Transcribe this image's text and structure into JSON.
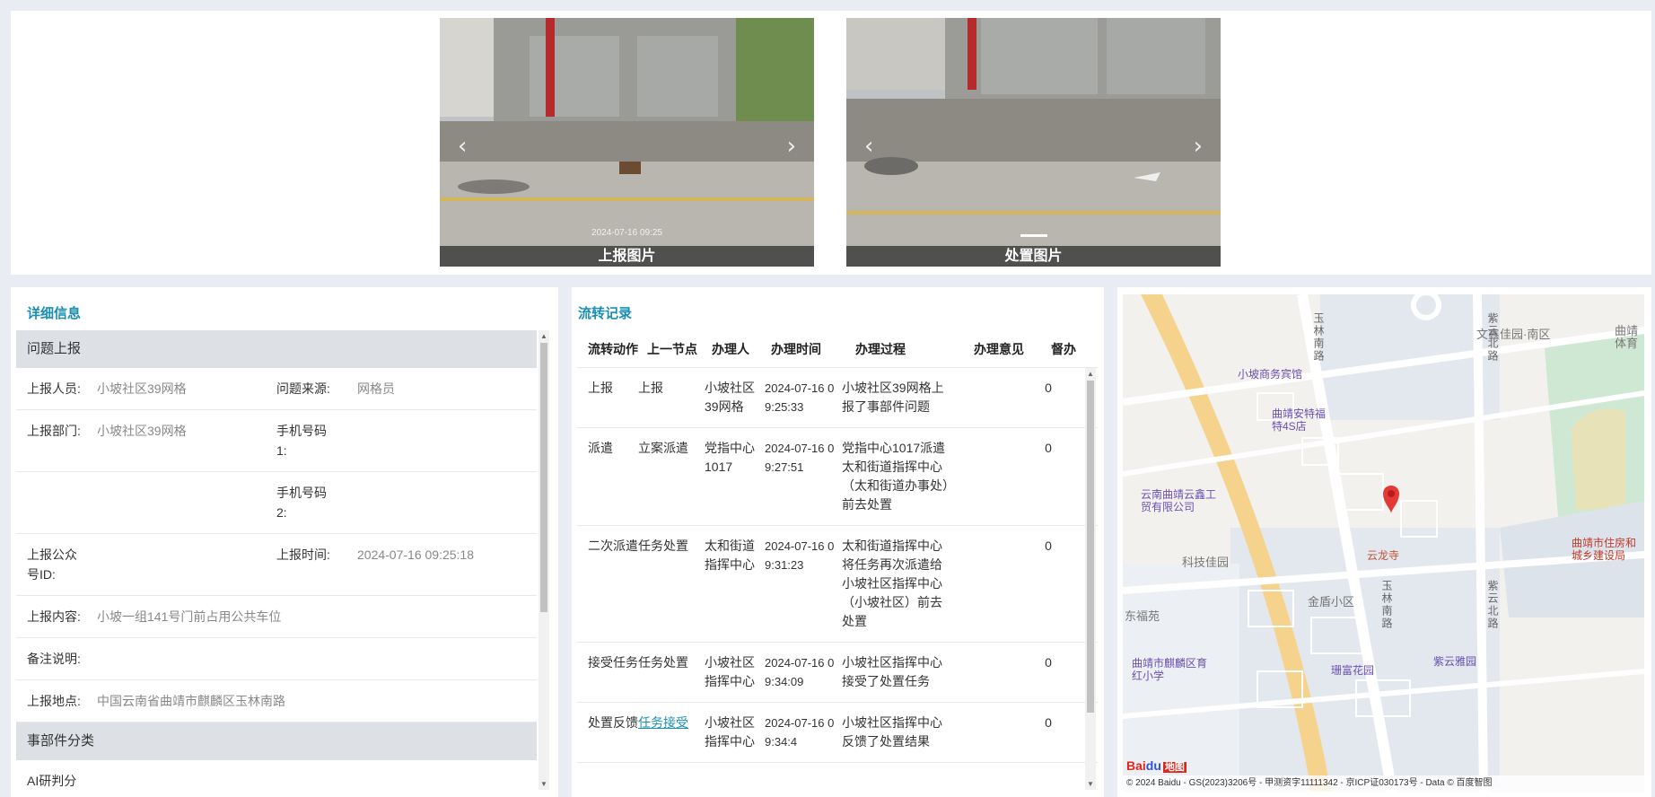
{
  "photos": {
    "report": {
      "caption": "上报图片",
      "stamp": "2024-07-16 09:25"
    },
    "handle": {
      "caption": "处置图片"
    },
    "prev_arrow": "‹",
    "next_arrow": "›"
  },
  "detail": {
    "title": "详细信息",
    "section_report": "问题上报",
    "rows": [
      {
        "l1": "上报人员:",
        "v1": "小坡社区39网格",
        "l2": "问题来源:",
        "v2": "网格员"
      },
      {
        "l1": "上报部门:",
        "v1": "小坡社区39网格",
        "l2": "手机号码1:",
        "v2": ""
      },
      {
        "l1": "",
        "v1": "",
        "l2": "手机号码2:",
        "v2": ""
      },
      {
        "l1": "上报公众号ID:",
        "v1": "",
        "l2": "上报时间:",
        "v2": "2024-07-16 09:25:18"
      }
    ],
    "content_label": "上报内容:",
    "content_value": "小坡一组141号门前占用公共车位",
    "remark_label": "备注说明:",
    "remark_value": "",
    "location_label": "上报地点:",
    "location_value": "中国云南省曲靖市麒麟区玉林南路",
    "section_category": "事部件分类",
    "ai_label": "AI研判分类:"
  },
  "flow": {
    "title": "流转记录",
    "headers": [
      "流转动作",
      "上一节点",
      "办理人",
      "办理时间",
      "办理过程",
      "办理意见",
      "督办"
    ],
    "rows": [
      {
        "action": "上报",
        "prev": "上报",
        "who": "小坡社区39网格",
        "time": "2024-07-16 09:25:33",
        "proc": "小坡社区39网格上报了事部件问题",
        "opinion": "",
        "sup": "0"
      },
      {
        "action": "派遣",
        "prev": "立案派遣",
        "who": "党指中心1017",
        "time": "2024-07-16 09:27:51",
        "proc": "党指中心1017派遣太和街道指挥中心（太和街道办事处）前去处置",
        "opinion": "",
        "sup": "0"
      },
      {
        "action": "二次派遣",
        "prev": "任务处置",
        "who": "太和街道指挥中心",
        "time": "2024-07-16 09:31:23",
        "proc": "太和街道指挥中心将任务再次派遣给小坡社区指挥中心（小坡社区）前去处置",
        "opinion": "",
        "sup": "0"
      },
      {
        "action": "接受任务",
        "prev": "任务处置",
        "who": "小坡社区指挥中心",
        "time": "2024-07-16 09:34:09",
        "proc": "小坡社区指挥中心接受了处置任务",
        "opinion": "",
        "sup": "0"
      },
      {
        "action": "处置反馈",
        "prev": "任务接受",
        "who": "小坡社区指挥中心",
        "time": "2024-07-16 09:34:4",
        "proc": "小坡社区指挥中心反馈了处置结果",
        "opinion": "",
        "sup": "0"
      }
    ]
  },
  "map": {
    "labels": {
      "wenxin": "文鑫佳园·南区",
      "xiaopo_hotel": "小坡商务宾馆",
      "anteng": "曲靖安特福特4S店",
      "yunnan_co": "云南曲靖云鑫工贸有限公司",
      "keji": "科技佳园",
      "yunlong": "云龙寺",
      "jindun": "金盾小区",
      "dongfu": "东福苑",
      "qilin_school": "曲靖市麒麟区育红小学",
      "penfu": "珊富花园",
      "ziyun_ya": "紫云雅园",
      "housing_bureau": "曲靖市住房和城乡建设局",
      "yulin_road": "玉林南路",
      "yulin_road2": "玉林南路",
      "ziyun_north": "紫云北路",
      "ziyun_north2": "紫云北路",
      "qujing_gym": "曲靖体育"
    },
    "copyright": "© 2024 Baidu - GS(2023)3206号 - 甲测资字11111342 - 京ICP证030173号 - Data © 百度智图",
    "logo_a": "Bai",
    "logo_b": "du",
    "logo_c": "地图"
  }
}
